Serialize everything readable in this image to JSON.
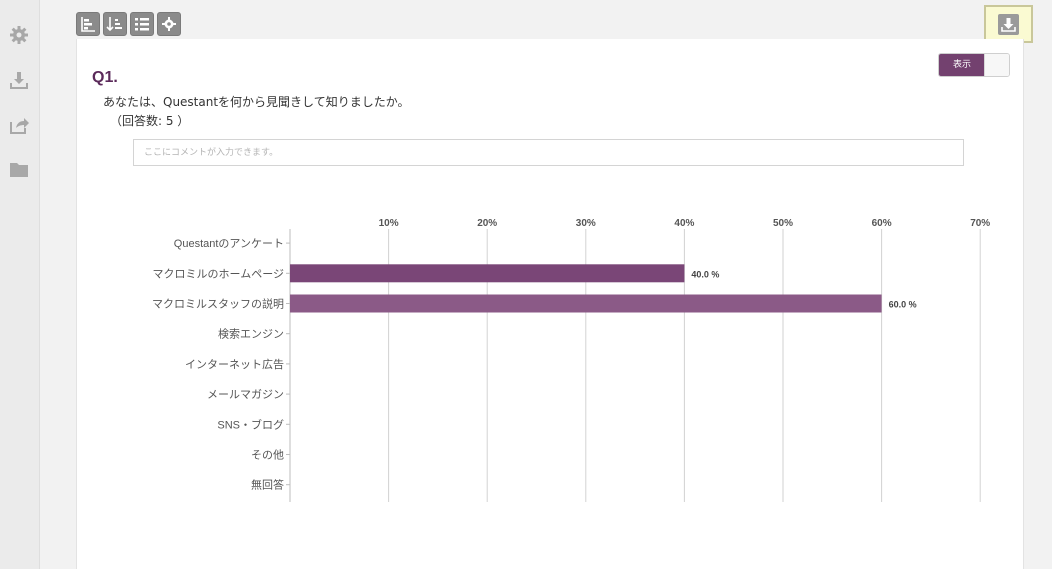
{
  "sidebar": {
    "items": [
      {
        "icon": "gear-icon"
      },
      {
        "icon": "download-icon"
      },
      {
        "icon": "share-icon"
      },
      {
        "icon": "folder-icon"
      }
    ]
  },
  "toolbar": {
    "items": [
      {
        "icon": "bar-chart-icon"
      },
      {
        "icon": "sort-icon"
      },
      {
        "icon": "list-icon"
      },
      {
        "icon": "settings-icon"
      }
    ],
    "download_icon": "download-icon"
  },
  "toggle": {
    "label": "表示",
    "on": true
  },
  "question": {
    "number": "Q1.",
    "text": "あなたは、Questantを何から見聞きして知りましたか。",
    "count": "（回答数: 5 ）"
  },
  "comment": {
    "placeholder": "ここにコメントが入力できます。",
    "value": ""
  },
  "colors": {
    "accent": "#73416f",
    "bar1": "#7a4677",
    "bar2": "#8b5a87",
    "highlight": "#fafad2"
  },
  "chart_data": {
    "type": "bar",
    "orientation": "horizontal",
    "categories": [
      "Questantのアンケート",
      "マクロミルのホームページ",
      "マクロミルスタッフの説明",
      "検索エンジン",
      "インターネット広告",
      "メールマガジン",
      "SNS・ブログ",
      "その他",
      "無回答"
    ],
    "values": [
      0,
      40.0,
      60.0,
      0,
      0,
      0,
      0,
      0,
      0
    ],
    "value_labels": [
      "",
      "40.0 %",
      "60.0 %",
      "",
      "",
      "",
      "",
      "",
      ""
    ],
    "ticks": [
      10,
      20,
      30,
      40,
      50,
      60,
      70
    ],
    "tick_labels": [
      "10%",
      "20%",
      "30%",
      "40%",
      "50%",
      "60%",
      "70%"
    ],
    "xlim": [
      0,
      70
    ],
    "grid": true
  }
}
